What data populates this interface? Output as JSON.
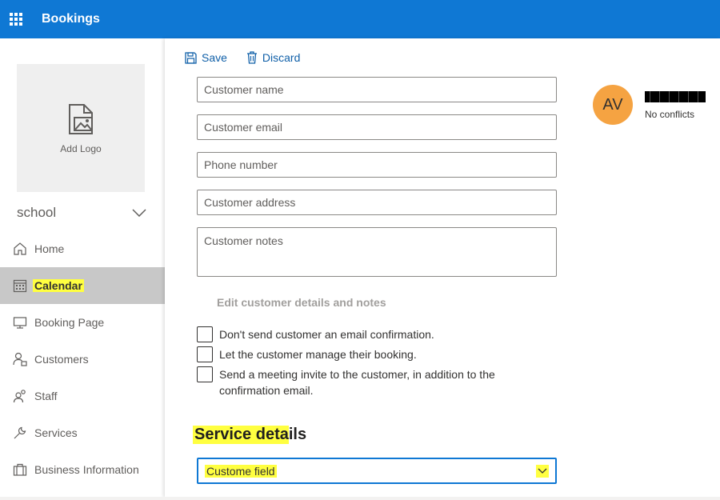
{
  "app": {
    "title": "Bookings"
  },
  "sidebar": {
    "logo_label": "Add Logo",
    "business_name": "school",
    "items": [
      {
        "label": "Home",
        "icon": "home-icon"
      },
      {
        "label": "Calendar",
        "icon": "calendar-icon",
        "active": true
      },
      {
        "label": "Booking Page",
        "icon": "monitor-icon"
      },
      {
        "label": "Customers",
        "icon": "customers-icon"
      },
      {
        "label": "Staff",
        "icon": "staff-icon"
      },
      {
        "label": "Services",
        "icon": "wrench-icon"
      },
      {
        "label": "Business Information",
        "icon": "briefcase-icon"
      }
    ]
  },
  "toolbar": {
    "save_label": "Save",
    "discard_label": "Discard"
  },
  "form": {
    "customer_name_placeholder": "Customer name",
    "customer_email_placeholder": "Customer email",
    "phone_placeholder": "Phone number",
    "address_placeholder": "Customer address",
    "notes_placeholder": "Customer notes",
    "edit_link": "Edit customer details and notes",
    "checkboxes": [
      {
        "label": "Don't send customer an email confirmation.",
        "checked": false
      },
      {
        "label": "Let the customer manage their booking.",
        "checked": false
      },
      {
        "label": "Send a meeting invite to the customer, in addition to the confirmation email.",
        "checked": false
      }
    ],
    "service_section_title": "Service details",
    "service_dropdown_value": "Custome field"
  },
  "staff": {
    "initials": "AV",
    "status": "No conflicts"
  },
  "colors": {
    "brand": "#0f78d4",
    "highlight": "#ffff40",
    "avatar": "#f5a342"
  }
}
